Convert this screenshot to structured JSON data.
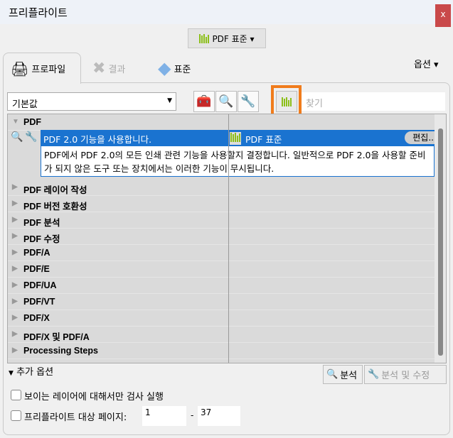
{
  "window": {
    "title": "프리플라이트",
    "close": "x"
  },
  "toolbar": {
    "standard_button": "PDF 표준 ▾"
  },
  "tabs": [
    {
      "label": "프로파일"
    },
    {
      "label": "결과"
    },
    {
      "label": "표준"
    }
  ],
  "options_menu": "옵션 ▾",
  "preset": {
    "value": "기본값"
  },
  "search": {
    "placeholder": "찾기"
  },
  "tree": {
    "group": "PDF",
    "selected": {
      "label": "PDF 2.0 기능을 사용합니다.",
      "category": "PDF 표준",
      "edit": "편집...",
      "description": "PDF에서 PDF 2.0의 모든 인쇄 관련 기능을 사용할지 결정합니다. 일반적으로 PDF 2.0을 사용할 준비가 되지 않은 도구 또는 장치에서는 이러한 기능이 무시됩니다."
    },
    "items": [
      "PDF 레이어 작성",
      "PDF 버전 호환성",
      "PDF 분석",
      "PDF 수정",
      "PDF/A",
      "PDF/E",
      "PDF/UA",
      "PDF/VT",
      "PDF/X",
      "PDF/X 및 PDF/A",
      "Processing Steps"
    ]
  },
  "bottom": {
    "more_options": "추가 옵션",
    "analyze": "분석",
    "analyze_fix": "분석 및 수정",
    "visible_layers": "보이는 레이어에 대해서만 검사 실행",
    "pages_label": "프리플라이트 대상 페이지:",
    "page_from": "1",
    "dash": "-",
    "page_to": "37"
  }
}
